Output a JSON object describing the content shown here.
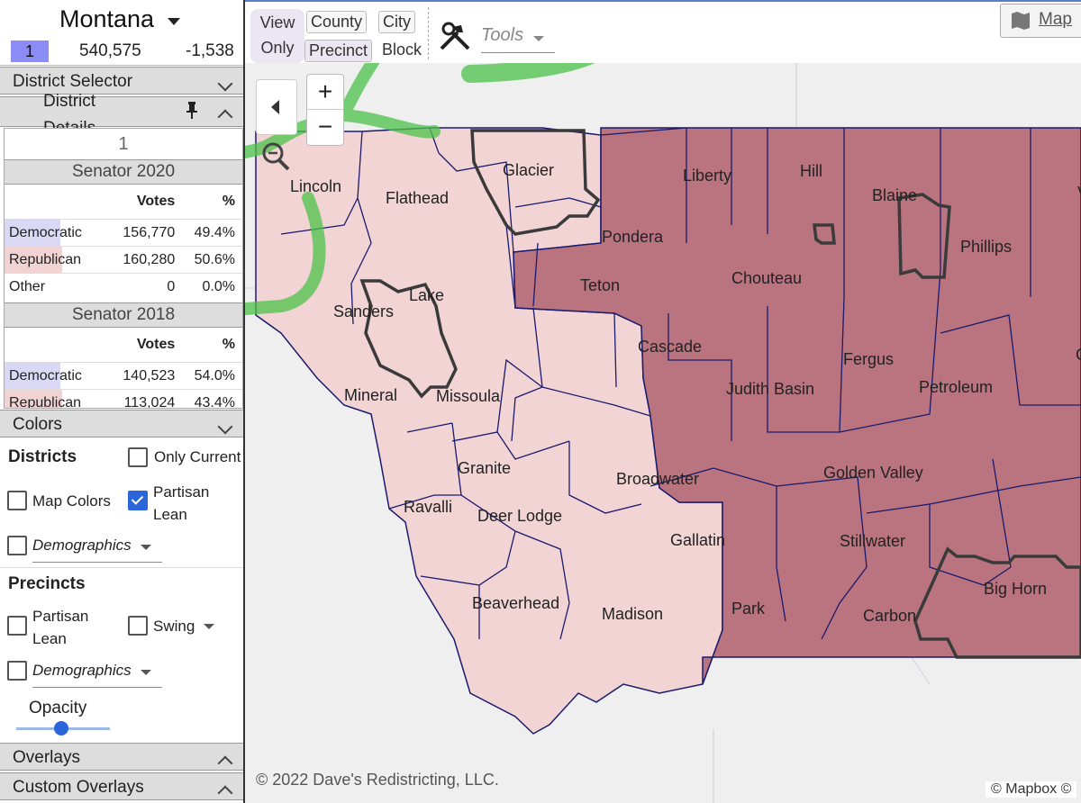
{
  "header": {
    "state": "Montana",
    "district_number": "1",
    "population": "540,575",
    "deviation": "-1,538"
  },
  "sections": {
    "district_selector": "District Selector",
    "district_details": "District\nDetails",
    "colors": "Colors",
    "overlays": "Overlays",
    "custom_overlays": "Custom Overlays"
  },
  "details": {
    "district_label": "1",
    "elections": [
      {
        "title": "Senator 2020",
        "votes_header": "Votes",
        "pct_header": "%",
        "rows": [
          {
            "party": "Democratic",
            "votes": "156,770",
            "pct": "49.4%"
          },
          {
            "party": "Republican",
            "votes": "160,280",
            "pct": "50.6%"
          },
          {
            "party": "Other",
            "votes": "0",
            "pct": "0.0%"
          }
        ]
      },
      {
        "title": "Senator 2018",
        "votes_header": "Votes",
        "pct_header": "%",
        "rows": [
          {
            "party": "Democratic",
            "votes": "140,523",
            "pct": "54.0%"
          },
          {
            "party": "Republican",
            "votes": "113,024",
            "pct": "43.4%"
          }
        ]
      }
    ]
  },
  "colors": {
    "districts_heading": "Districts",
    "only_current": "Only Current",
    "map_colors": "Map Colors",
    "partisan_lean": "Partisan Lean",
    "demographics": "Demographics",
    "precincts_heading": "Precincts",
    "precinct_partisan_lean": "Partisan Lean",
    "swing": "Swing",
    "precinct_demographics": "Demographics",
    "opacity": "Opacity",
    "opacity_value": 0.45,
    "partisan_lean_checked": true
  },
  "toolbar": {
    "view_only": "View Only",
    "county": "County",
    "city": "City",
    "precinct": "Precinct",
    "block": "Block",
    "tools": "Tools",
    "map": "Map"
  },
  "map": {
    "zoom_in": "+",
    "zoom_out": "−",
    "attribution": "© 2022 Dave's Redistricting, LLC.",
    "mapbox": "© Mapbox ©",
    "colors": {
      "dem_lean": "#f2d4d4",
      "rep_lean": "#b9747f",
      "border": "#1a1a6e",
      "annotation": "#4cc24a"
    },
    "counties": [
      "Lincoln",
      "Flathead",
      "Glacier",
      "Liberty",
      "Hill",
      "Blaine",
      "Phillips",
      "Pondera",
      "Teton",
      "Chouteau",
      "Lake",
      "Sanders",
      "Cascade",
      "Fergus",
      "Mineral",
      "Missoula",
      "Judith Basin",
      "Petroleum",
      "Granite",
      "Broadwater",
      "Golden Valley",
      "Ravalli",
      "Deer Lodge",
      "Gallatin",
      "Stillwater",
      "Big Horn",
      "Beaverhead",
      "Madison",
      "Park",
      "Carbon",
      "Ga",
      "V"
    ]
  }
}
